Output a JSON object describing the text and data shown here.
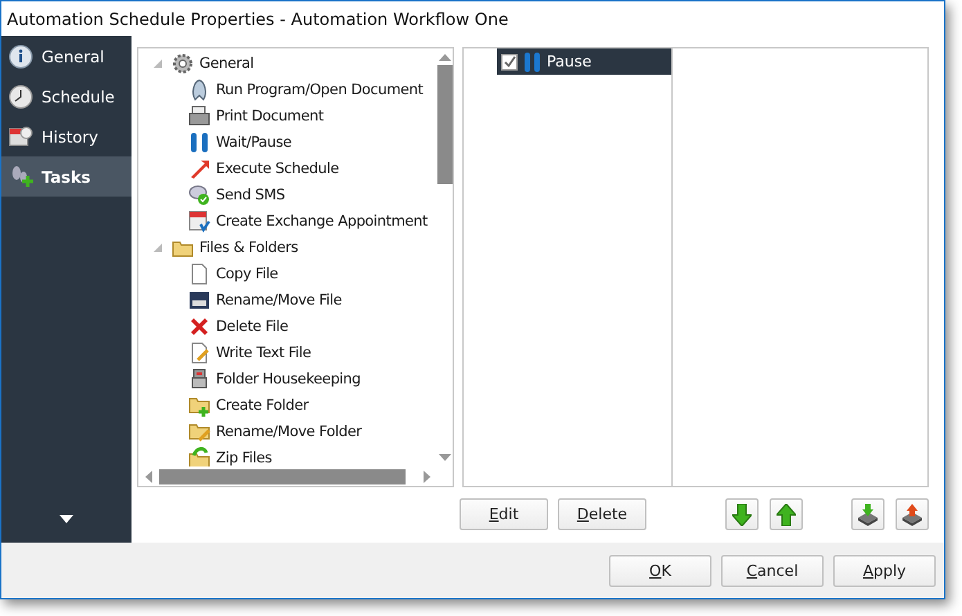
{
  "window": {
    "title": "Automation Schedule Properties - Automation Workflow One"
  },
  "sidebar": {
    "items": [
      {
        "label": "General",
        "selected": false
      },
      {
        "label": "Schedule",
        "selected": false
      },
      {
        "label": "History",
        "selected": false
      },
      {
        "label": "Tasks",
        "selected": true
      }
    ]
  },
  "task_tree": [
    {
      "label": "General",
      "expanded": true,
      "children": [
        {
          "label": "Run Program/Open Document"
        },
        {
          "label": "Print Document"
        },
        {
          "label": "Wait/Pause"
        },
        {
          "label": "Execute Schedule"
        },
        {
          "label": "Send SMS"
        },
        {
          "label": "Create Exchange Appointment"
        }
      ]
    },
    {
      "label": "Files & Folders",
      "expanded": true,
      "children": [
        {
          "label": "Copy File"
        },
        {
          "label": "Rename/Move File"
        },
        {
          "label": "Delete File"
        },
        {
          "label": "Write Text File"
        },
        {
          "label": "Folder Housekeeping"
        },
        {
          "label": "Create Folder"
        },
        {
          "label": "Rename/Move Folder"
        },
        {
          "label": "Zip Files"
        }
      ]
    }
  ],
  "task_list": [
    {
      "label": "Pause",
      "checked": true,
      "selected": true
    }
  ],
  "list_buttons": [
    {
      "label": "Edit"
    },
    {
      "label": "Delete"
    }
  ],
  "footer_buttons": [
    {
      "label": "OK"
    },
    {
      "label": "Cancel"
    },
    {
      "label": "Apply"
    }
  ]
}
